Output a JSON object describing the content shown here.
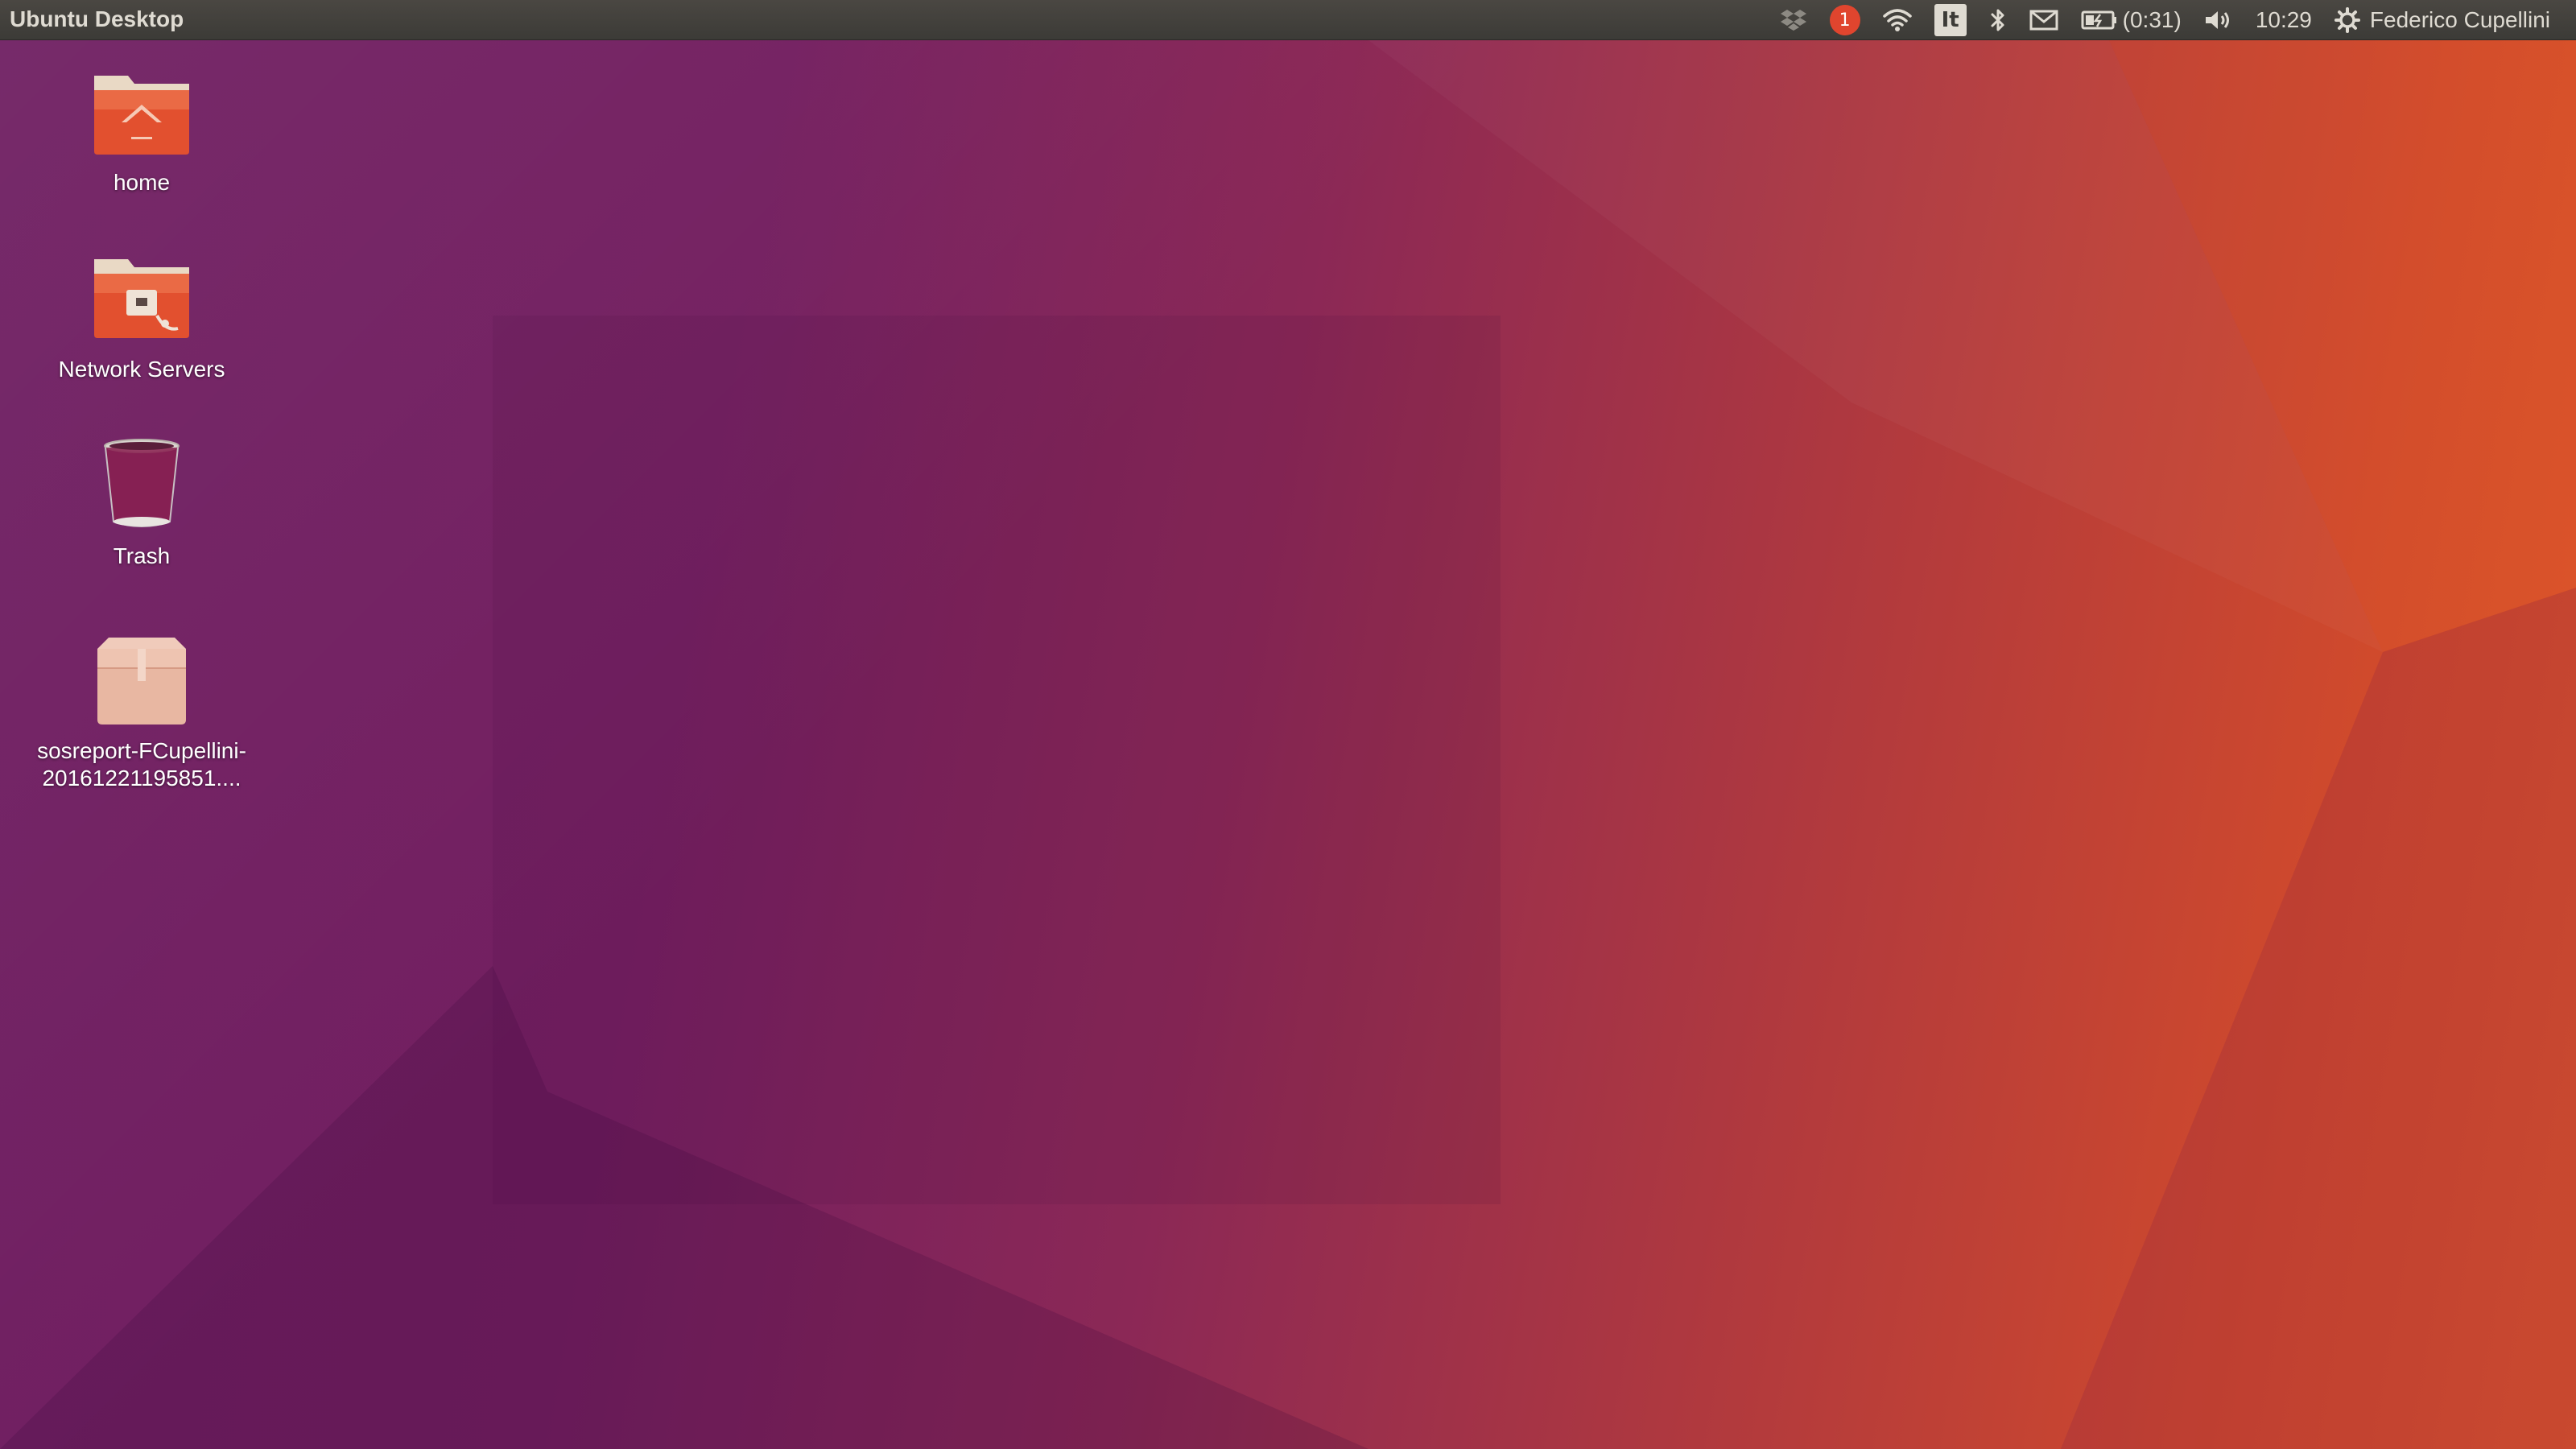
{
  "panel": {
    "title": "Ubuntu Desktop",
    "indicators": {
      "notification_count": "1",
      "keyboard_layout": "It",
      "battery_time": "(0:31)",
      "clock": "10:29",
      "user_name": "Federico Cupellini"
    },
    "icons": [
      "dropbox-icon",
      "notification-icon",
      "wifi-icon",
      "keyboard-layout-icon",
      "bluetooth-icon",
      "mail-icon",
      "battery-icon",
      "volume-icon",
      "session-gear-icon"
    ]
  },
  "desktop": {
    "items": [
      {
        "label": "home",
        "icon": "home-folder-icon"
      },
      {
        "label": "Network Servers",
        "icon": "network-folder-icon"
      },
      {
        "label": "Trash",
        "icon": "trash-icon"
      },
      {
        "label": "sosreport-FCupellini-20161221195851....",
        "icon": "archive-icon"
      }
    ]
  },
  "colors": {
    "panel_bg": "#3c3b37",
    "panel_text": "#dfdbd2",
    "folder_orange": "#e2502f",
    "wallpaper_purple": "#731f60",
    "wallpaper_orange": "#db552a"
  }
}
